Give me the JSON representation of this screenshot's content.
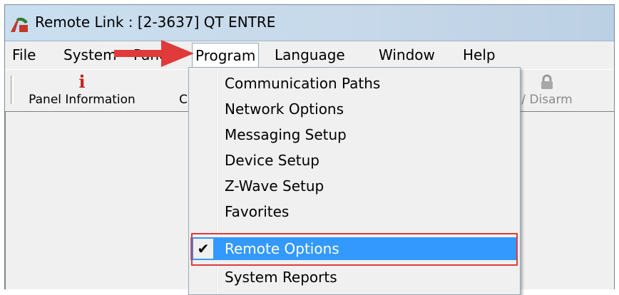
{
  "window": {
    "title": "Remote Link : [2-3637] QT ENTRE"
  },
  "menubar": {
    "items": [
      "File",
      "System",
      "Panel",
      "Program",
      "Language",
      "Window",
      "Help"
    ],
    "active": "Program"
  },
  "toolbar": {
    "buttons": [
      {
        "label": "Panel Information",
        "icon": "info-icon",
        "enabled": true
      },
      {
        "label": "C",
        "icon": "",
        "enabled": true
      },
      {
        "label": "/ Disarm",
        "icon": "lock-icon",
        "enabled": false
      }
    ]
  },
  "program_menu": {
    "items": [
      {
        "label": "Communication Paths",
        "checked": false,
        "selected": false
      },
      {
        "label": "Network Options",
        "checked": false,
        "selected": false
      },
      {
        "label": "Messaging Setup",
        "checked": false,
        "selected": false
      },
      {
        "label": "Device Setup",
        "checked": false,
        "selected": false
      },
      {
        "label": "Z-Wave Setup",
        "checked": false,
        "selected": false
      },
      {
        "label": "Favorites",
        "checked": false,
        "selected": false
      },
      {
        "label": "Remote Options",
        "checked": true,
        "selected": true
      },
      {
        "label": "System Reports",
        "checked": false,
        "selected": false
      }
    ],
    "check_glyph": "✔"
  },
  "colors": {
    "selection": "#3399ff",
    "annotation": "#e03a3a",
    "info_icon": "#c0241f"
  }
}
